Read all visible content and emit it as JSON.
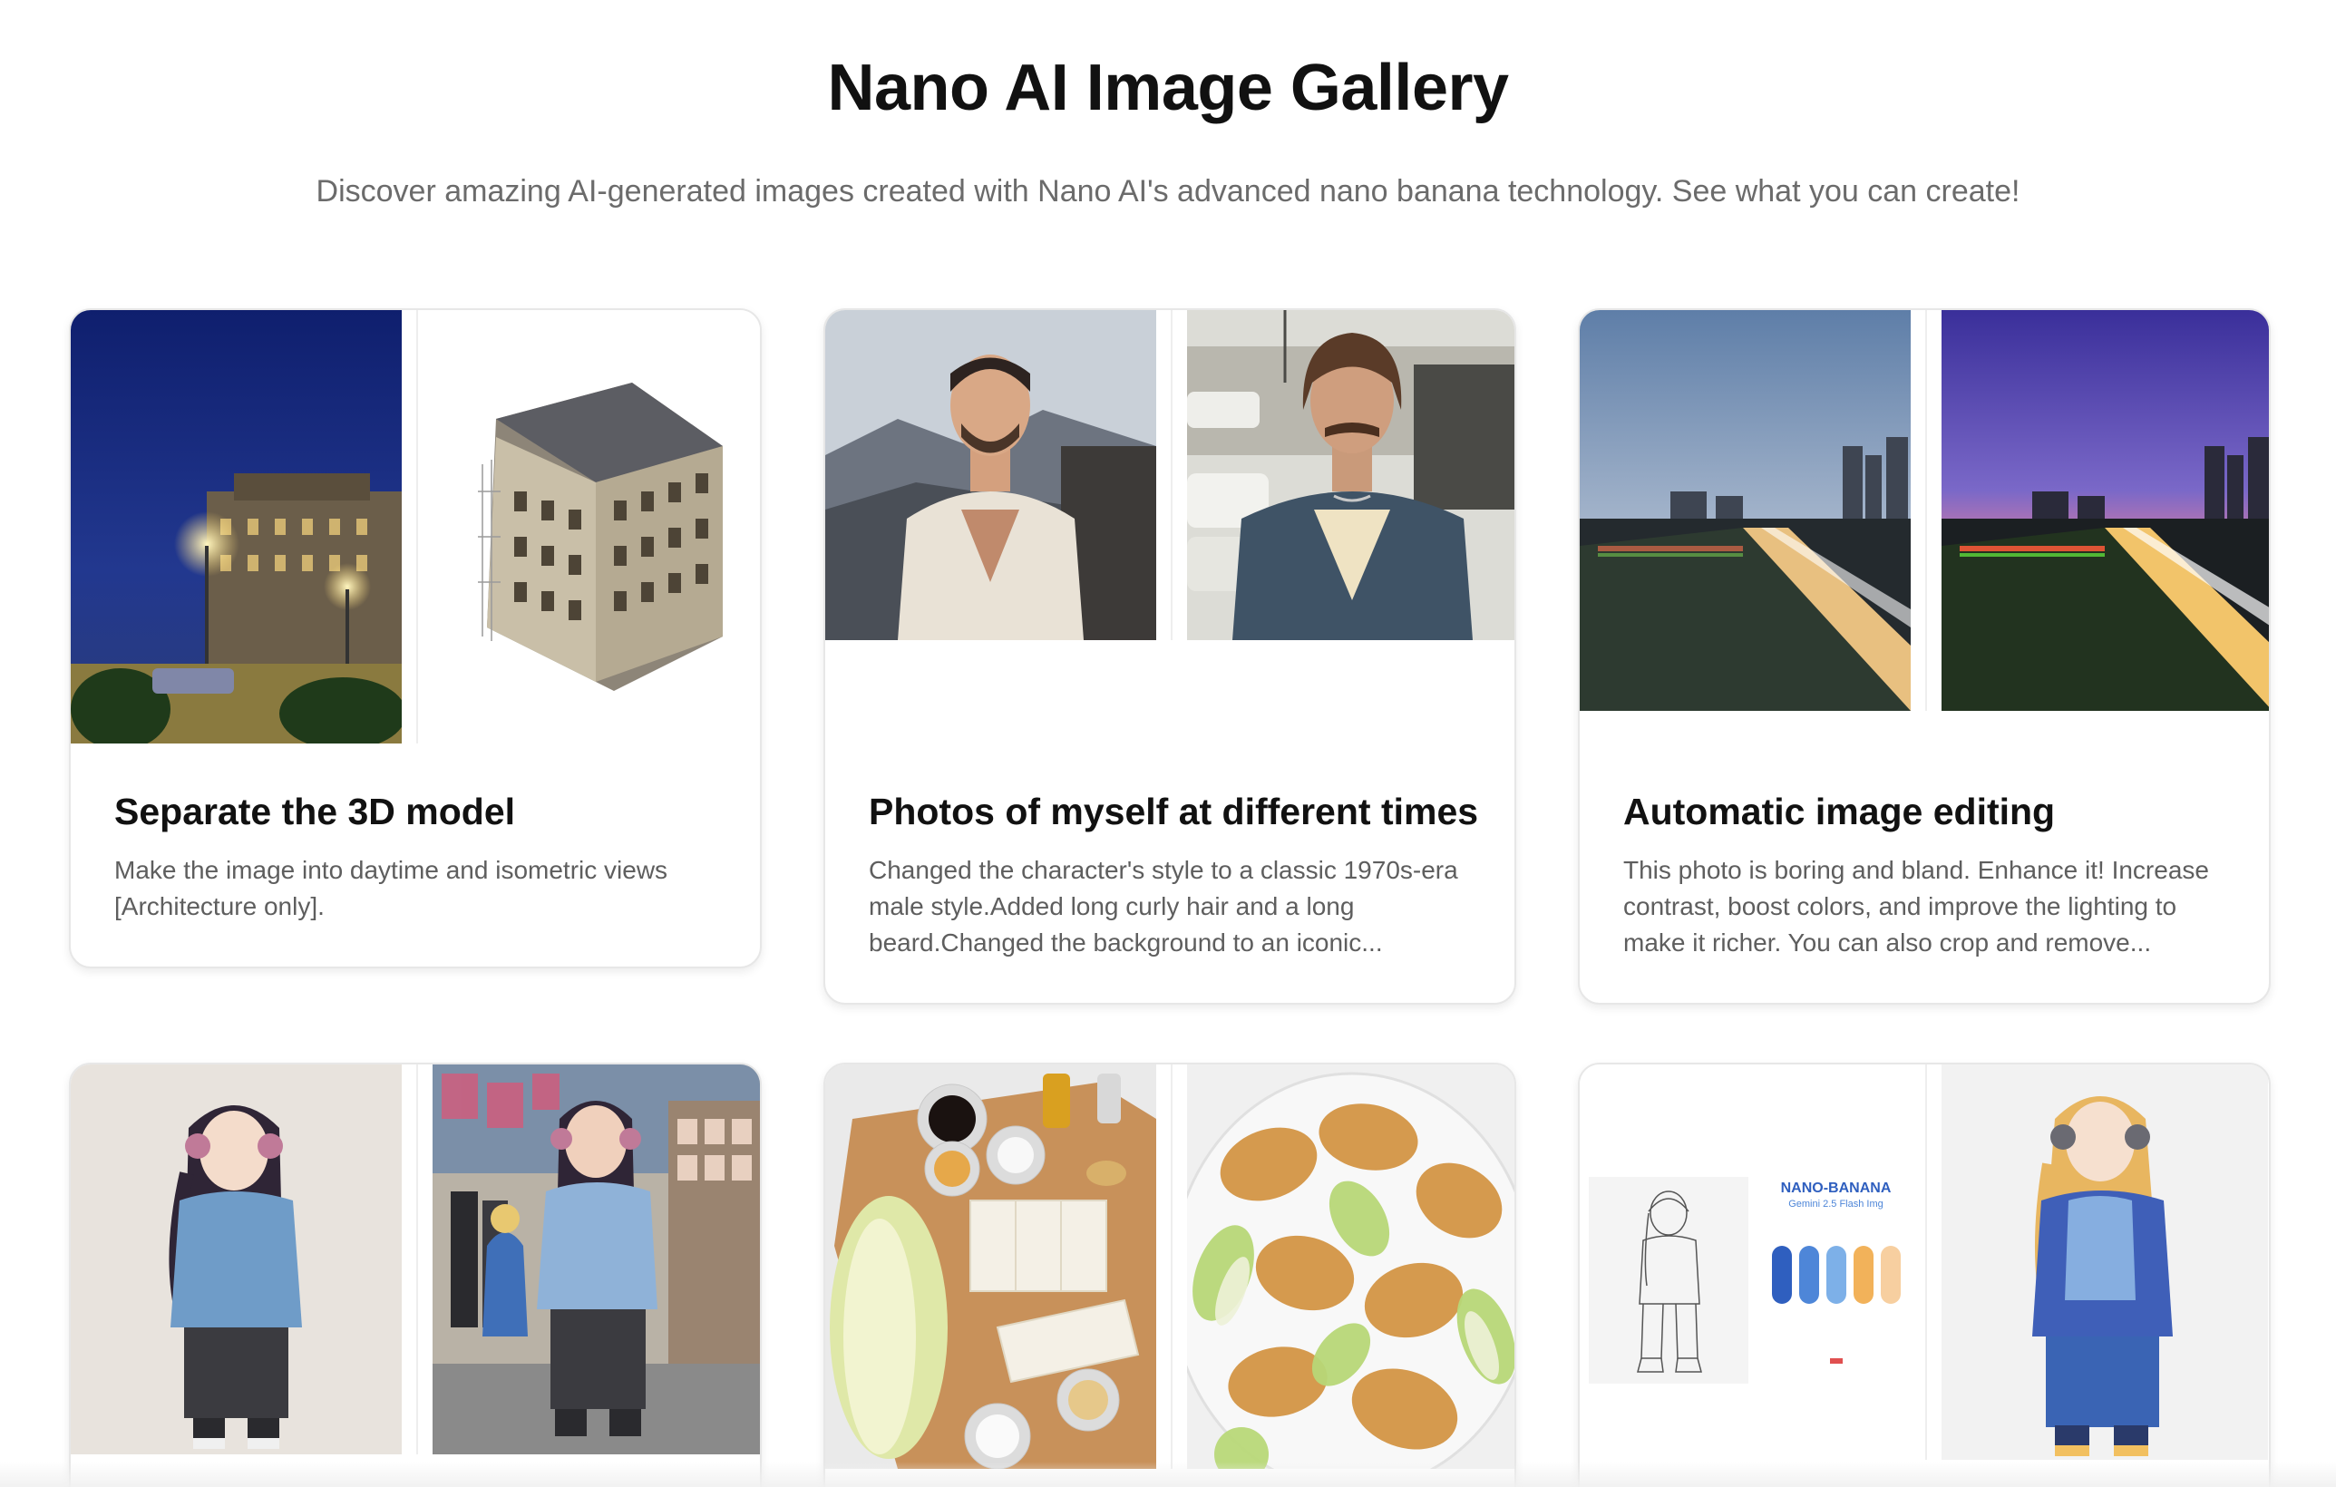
{
  "header": {
    "title": "Nano AI Image Gallery",
    "subtitle": "Discover amazing AI-generated images created with Nano AI's advanced nano banana technology. See what you can create!"
  },
  "cards": [
    {
      "title": "Separate the 3D model",
      "description": "Make the image into daytime and isometric views [Architecture only].",
      "before_image": "night city street with lit building and lamps",
      "after_image": "isometric 3D model of a classical building"
    },
    {
      "title": "Photos of myself at different times",
      "description": "Changed the character's style to a classic 1970s-era male style.Added long curly hair and a long beard.Changed the background to an iconic...",
      "before_image": "portrait of a man in a light shirt against mountains",
      "after_image": "1970s style portrait of a man with long hair and mustache near classic cars"
    },
    {
      "title": "Automatic image editing",
      "description": "This photo is boring and bland. Enhance it! Increase contrast, boost colors, and improve the lighting to make it richer. You can also crop and remove...",
      "before_image": "dusk bridge walkway with city skyline",
      "after_image": "enhanced vivid dusk bridge walkway with purple sky"
    },
    {
      "title": "",
      "description": "",
      "before_image": "anime girl with headphones in blue hoodie",
      "after_image": "realistic cosplay of anime girl at convention"
    },
    {
      "title": "",
      "description": "",
      "before_image": "raw ingredients: napa cabbage, tofu, sauces on cutting board",
      "after_image": "cooked dish of fried tofu with cabbage"
    },
    {
      "title": "",
      "description": "",
      "before_image": "line sketch with color palette reference",
      "after_image": "colored anime girl in blue hoodie"
    }
  ],
  "palette_card": {
    "brand": "NANO-BANANA",
    "model": "Gemini 2.5 Flash Img",
    "swatches": [
      "#2f5fbf",
      "#4e86d8",
      "#7db0e8",
      "#f2b25a",
      "#f7cfa0"
    ]
  }
}
